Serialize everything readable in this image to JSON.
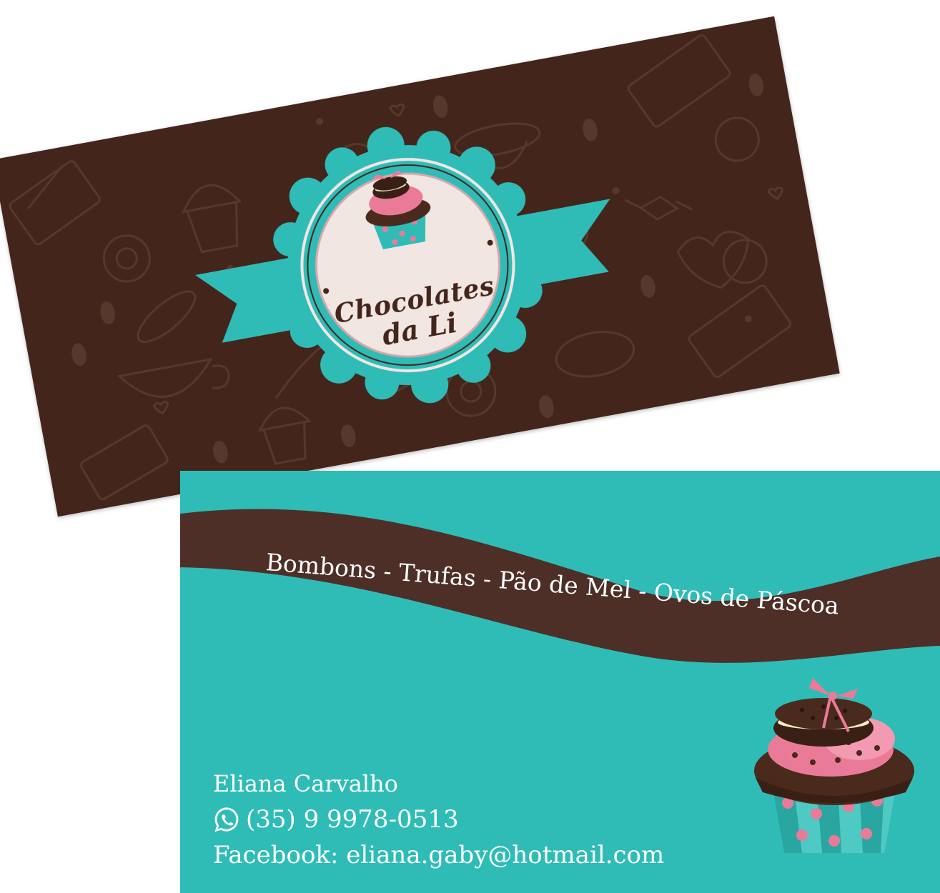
{
  "front_card": {
    "logo_line1": "Chocolates",
    "logo_line2": "da Li",
    "colors": {
      "background": "#43251c",
      "pattern": "#55362c",
      "ribbon": "#2fbcb7",
      "badge_inner": "#f2e6e2",
      "cupcake_frosting": "#ea7b98",
      "cupcake_chocolate": "#4a2a1c"
    },
    "icons": [
      "cupcake-icon",
      "chocolate-bar-icon",
      "teacup-icon",
      "candy-icon",
      "bonbon-icon",
      "heart-icon"
    ]
  },
  "back_card": {
    "tagline": "Bombons - Trufas - Pão de Mel - Ovos de Páscoa",
    "contact": {
      "name": "Eliana Carvalho",
      "phone": "(35) 9 9978-0513",
      "facebook": "Facebook: eliana.gaby@hotmail.com"
    },
    "colors": {
      "background": "#2fbcb7",
      "band": "#4e2f27",
      "text": "#ffffff"
    },
    "icons": [
      "whatsapp-icon",
      "cupcake-icon"
    ]
  }
}
